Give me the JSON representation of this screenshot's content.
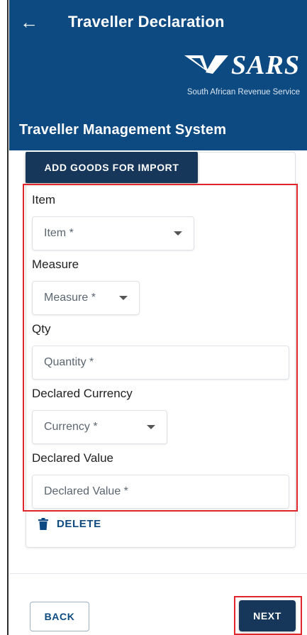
{
  "appbar": {
    "title": "Traveller Declaration",
    "back_icon": "arrow-left-icon"
  },
  "brand": {
    "logo_text": "SARS",
    "tagline": "South African Revenue Service"
  },
  "subheader": {
    "title": "Traveller Management System"
  },
  "form": {
    "section_button": "ADD GOODS FOR IMPORT",
    "item": {
      "label": "Item",
      "placeholder": "Item *"
    },
    "measure": {
      "label": "Measure",
      "placeholder": "Measure *"
    },
    "qty": {
      "label": "Qty",
      "placeholder": "Quantity *"
    },
    "currency": {
      "label": "Declared Currency",
      "placeholder": "Currency *"
    },
    "value": {
      "label": "Declared Value",
      "placeholder": "Declared Value *"
    },
    "delete_label": "DELETE"
  },
  "footer": {
    "back_label": "BACK",
    "next_label": "NEXT"
  },
  "colors": {
    "brand_blue": "#0d4a82",
    "button_navy": "#16365a",
    "highlight_red": "#e0262b"
  }
}
